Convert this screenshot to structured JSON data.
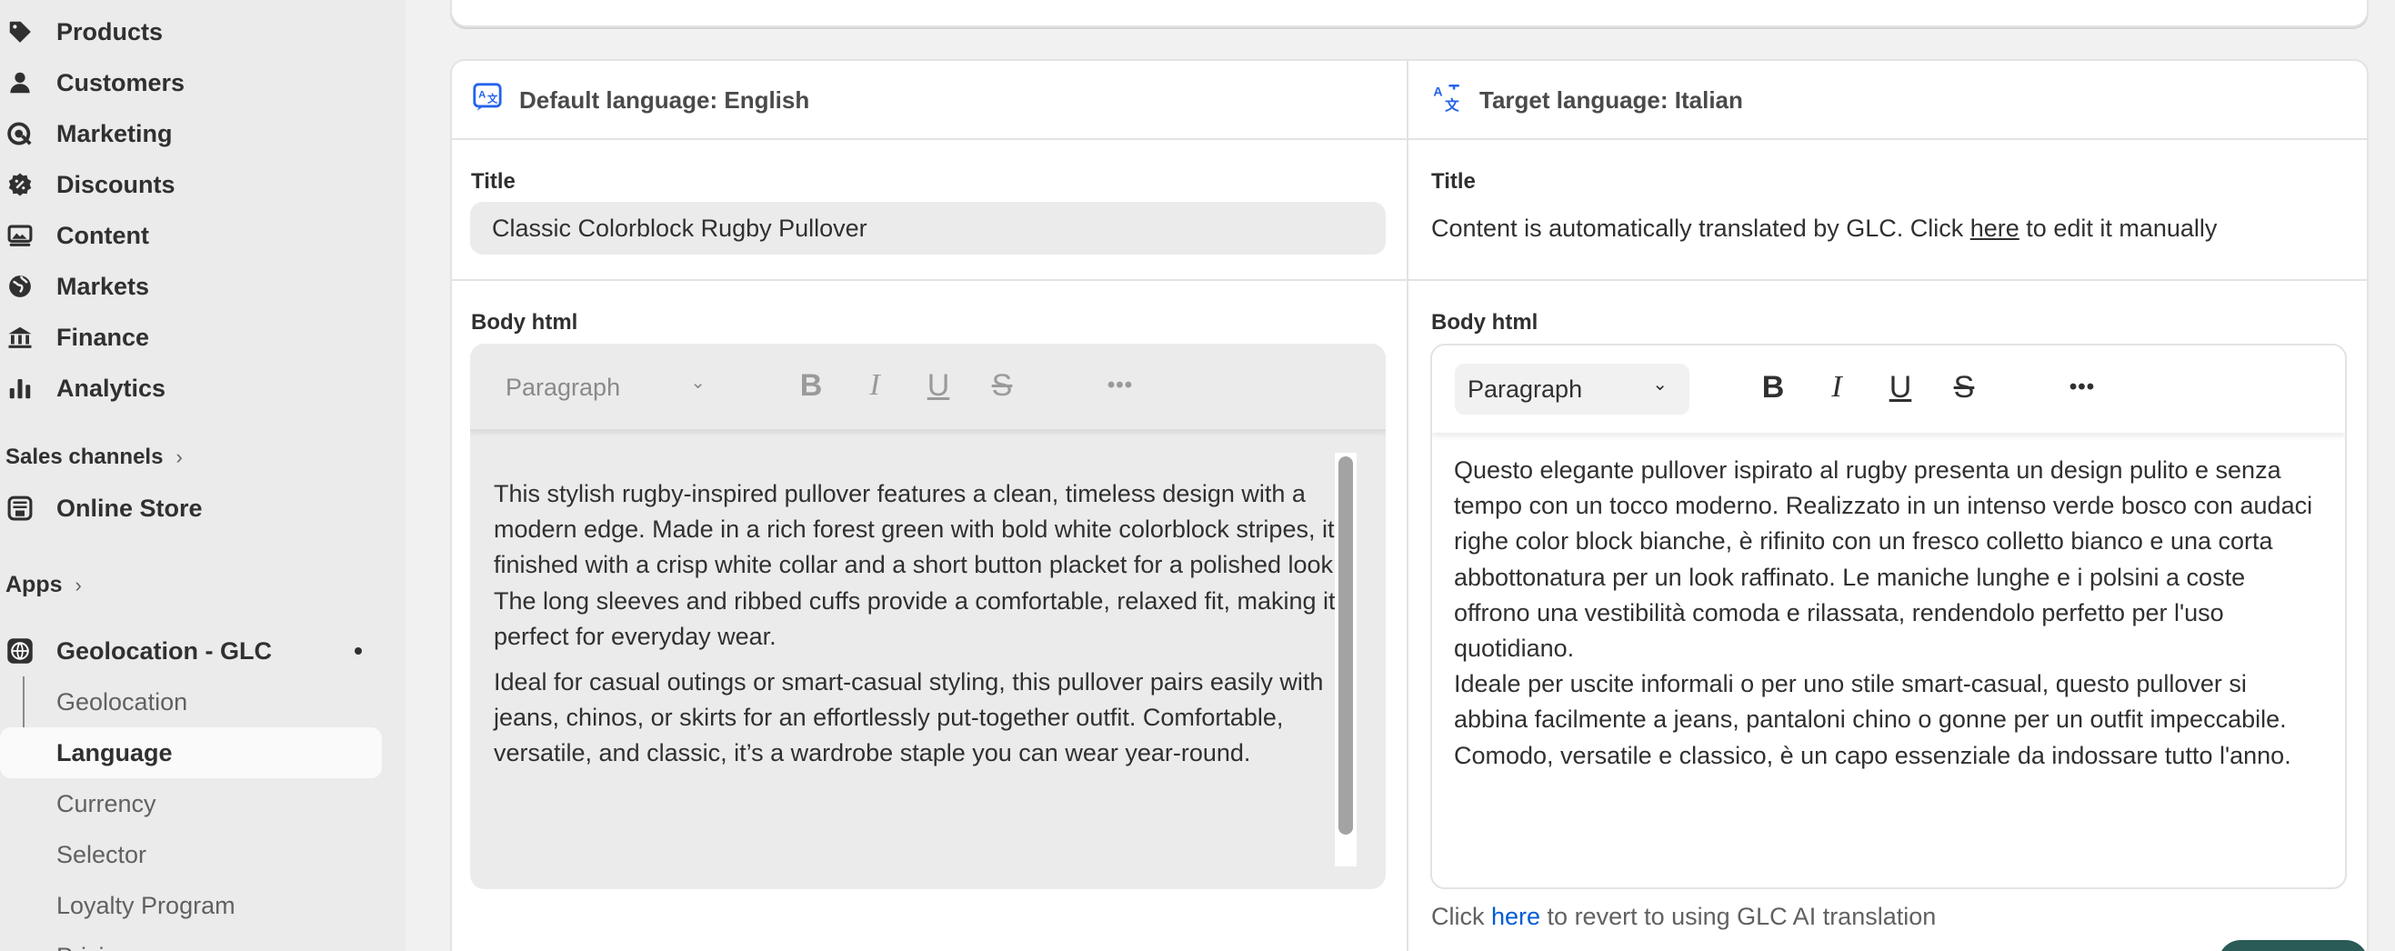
{
  "sidebar": {
    "items": [
      {
        "label": "Products",
        "icon": "tag-icon"
      },
      {
        "label": "Customers",
        "icon": "person-icon"
      },
      {
        "label": "Marketing",
        "icon": "target-icon"
      },
      {
        "label": "Discounts",
        "icon": "discount-icon"
      },
      {
        "label": "Content",
        "icon": "image-icon"
      },
      {
        "label": "Markets",
        "icon": "globe-icon"
      },
      {
        "label": "Finance",
        "icon": "bank-icon"
      },
      {
        "label": "Analytics",
        "icon": "bar-chart-icon"
      }
    ],
    "sales_channels_label": "Sales channels",
    "online_store_label": "Online Store",
    "apps_label": "Apps",
    "app_name": "Geolocation - GLC",
    "app_sub_items": [
      "Geolocation",
      "Language",
      "Currency",
      "Selector",
      "Loyalty Program",
      "Pricing"
    ],
    "active_sub_item": "Language"
  },
  "translation": {
    "default_language_label": "Default language: English",
    "target_language_label": "Target language: Italian",
    "title_label": "Title",
    "body_label": "Body html",
    "source_title": "Classic Colorblock Rugby Pullover",
    "auto_note_before": "Content is automatically translated by GLC. Click ",
    "auto_note_link": "here",
    "auto_note_after": " to edit it manually",
    "paragraph_select": "Paragraph",
    "source_body": [
      "This stylish rugby-inspired pullover features a clean, timeless design with a modern edge. Made in a rich forest green with bold white colorblock stripes, it’s finished with a crisp white collar and a short button placket for a polished look. The long sleeves and ribbed cuffs provide a comfortable, relaxed fit, making it perfect for everyday wear.",
      "Ideal for casual outings or smart-casual styling, this pullover pairs easily with jeans, chinos, or skirts for an effortlessly put-together outfit. Comfortable, versatile, and classic, it’s a wardrobe staple you can wear year-round."
    ],
    "target_body": [
      "Questo elegante pullover ispirato al rugby presenta un design pulito e senza tempo con un tocco moderno. Realizzato in un intenso verde bosco con audaci righe color block bianche, è rifinito con un fresco colletto bianco e una corta abbottonatura per un look raffinato. Le maniche lunghe e i polsini a coste offrono una vestibilità comoda e rilassata, rendendolo perfetto per l'uso quotidiano.",
      "Ideale per uscite informali o per uno stile smart-casual, questo pullover si abbina facilmente a jeans, pantaloni chino o gonne per un outfit impeccabile. Comodo, versatile e classico, è un capo essenziale da indossare tutto l'anno."
    ],
    "revert_before": "Click ",
    "revert_link": "here",
    "revert_after": " to revert to using GLC AI translation"
  },
  "toolbar": {
    "bold": "B",
    "italic": "I",
    "underline": "U",
    "strike": "S",
    "more": "•••",
    "caret": "⌄"
  },
  "colors": {
    "sidebar_bg": "#ebebeb",
    "page_bg": "#f1f1f1",
    "link_blue": "#005bd3",
    "language_icon_blue": "#2463eb",
    "save_button": "#2a5b56"
  }
}
